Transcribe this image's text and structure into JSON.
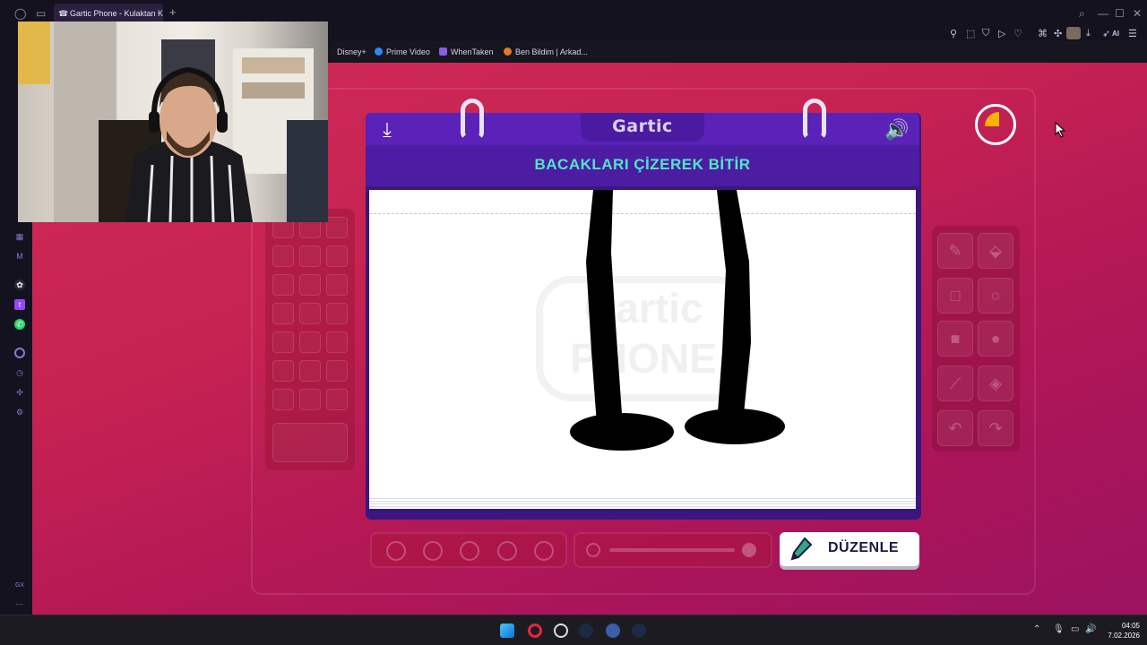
{
  "browser": {
    "tab_title": "Gartic Phone - Kulaktan Ku",
    "new_tab_symbol": "+",
    "toolbar_ai_label": "AI",
    "bookmarks": [
      "Disney+",
      "Prime Video",
      "WhenTaken",
      "Ben Bildim | Arkad..."
    ]
  },
  "game": {
    "logo_text": "Gartic",
    "watermark_text": "Gartic PHONE",
    "prompt": "BACAKLARI ÇİZEREK BİTİR",
    "edit_button_label": "DÜZENLE",
    "timer_remaining_fraction": 0.85,
    "colors": {
      "accent_purple": "#5a22b8",
      "prompt_teal": "#4ee8c6",
      "timer_yellow": "#f5b400",
      "background_pink": "#c72352"
    },
    "tools": [
      "pencil-icon",
      "eraser-icon",
      "rectangle-icon",
      "circle-icon",
      "filled-rectangle-icon",
      "filled-circle-icon",
      "line-icon",
      "fill-bucket-icon",
      "undo-icon",
      "redo-icon"
    ]
  },
  "taskbar": {
    "time": "04:05",
    "date": "7.02.2026"
  }
}
